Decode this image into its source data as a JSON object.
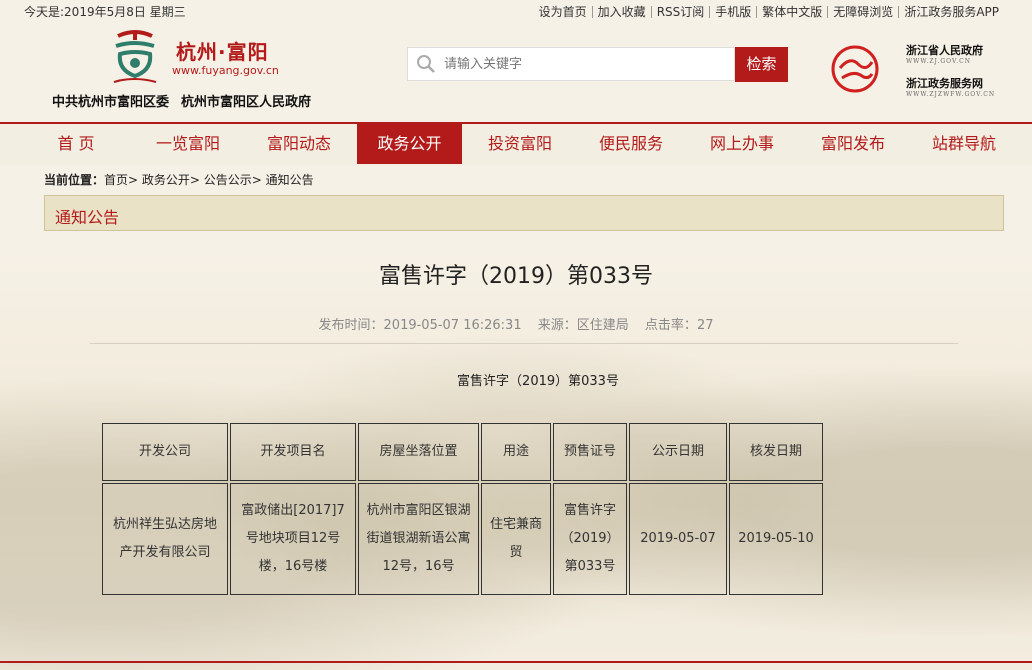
{
  "topbar": {
    "date": "今天是:2019年5月8日    星期三",
    "links": [
      "设为首页",
      "加入收藏",
      "RSS订阅",
      "手机版",
      "繁体中文版",
      "无障碍浏览",
      "浙江政务服务APP"
    ]
  },
  "header": {
    "site_name": "杭州·富阳",
    "site_url": "www.fuyang.gov.cn",
    "org1": "中共杭州市富阳区委",
    "org2": "杭州市富阳区人民政府",
    "search_placeholder": "请输入关键字",
    "search_button": "检索",
    "gov_link1": "浙江省人民政府",
    "gov_link1_sub": "WWW.ZJ.GOV.CN",
    "gov_link2": "浙江政务服务网",
    "gov_link2_sub": "WWW.ZJZWFW.GOV.CN"
  },
  "nav": {
    "items": [
      "首  页",
      "一览富阳",
      "富阳动态",
      "政务公开",
      "投资富阳",
      "便民服务",
      "网上办事",
      "富阳发布",
      "站群导航"
    ],
    "active_index": 3
  },
  "breadcrumb": {
    "prefix": "当前位置：",
    "path": "首页> 政务公开> 公告公示> 通知公告"
  },
  "section": {
    "title": "通知公告"
  },
  "article": {
    "title": "富售许字（2019）第033号",
    "publish_time_label": "发布时间：",
    "publish_time": "2019-05-07 16:26:31",
    "source_label": "来源：",
    "source": "区住建局",
    "clicks_label": "点击率：",
    "clicks": "27",
    "sub_title": "富售许字（2019）第033号"
  },
  "table": {
    "headers": [
      "开发公司",
      "开发项目名",
      "房屋坐落位置",
      "用途",
      "预售证号",
      "公示日期",
      "核发日期"
    ],
    "row": [
      "杭州祥生弘达房地产开发有限公司",
      "富政储出[2017]7号地块项目12号楼，16号楼",
      "杭州市富阳区银湖街道银湖新语公寓12号，16号",
      "住宅兼商贸",
      "富售许字（2019）第033号",
      "2019-05-07",
      "2019-05-10"
    ]
  },
  "colors": {
    "brand_red": "#b31b1b",
    "background": "#f6f1e6"
  }
}
